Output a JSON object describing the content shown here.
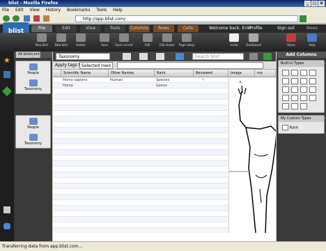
{
  "window": {
    "title": "blist - Mozilla Firefox"
  },
  "menu": [
    "File",
    "Edit",
    "View",
    "History",
    "Bookmarks",
    "Tools",
    "Help"
  ],
  "nav": {
    "url": "http://app.blist.com/"
  },
  "app_tabs": [
    "File",
    "Edit",
    "View",
    "Tools",
    "Columns",
    "Rows",
    "Cells"
  ],
  "header": {
    "welcome": "Welcome back, Erik!",
    "profile": "Profile",
    "signout": "Sign out",
    "news": "News"
  },
  "toolbar": {
    "items": [
      "New blist",
      "New blist",
      "Delete",
      "Save",
      "Save current",
      "",
      "Edit",
      "Edit shown",
      "Page setup",
      "",
      "Invite",
      "Dashboard",
      "",
      "Share",
      "Help"
    ]
  },
  "sidebar": {
    "title": "blists",
    "groups": [
      {
        "title": "Most Recent",
        "items": [
          "People",
          "Taxonomy"
        ]
      },
      {
        "title": "All blists",
        "items": [
          "People",
          "Taxonomy"
        ]
      }
    ]
  },
  "main": {
    "blist_select": "Taxonomy",
    "apply_label": "Apply tags to:",
    "apply_value": "Selected rows",
    "search_placeholder": "Search blist",
    "columns": [
      "Scientific Name",
      "Other Names",
      "Rank",
      "Reviewed",
      "Image",
      "mo"
    ],
    "rows": [
      [
        "Homo sapiens",
        "Human",
        "Species",
        ""
      ],
      [
        "Homo",
        "",
        "Genus",
        ""
      ]
    ]
  },
  "right_panel": {
    "title": "Add Columns",
    "builtin": "Built-in Types",
    "custom": "My Custom Types",
    "custom_items": [
      "Rank"
    ]
  },
  "status": {
    "text": "Transferring data from app.blist.com..."
  }
}
